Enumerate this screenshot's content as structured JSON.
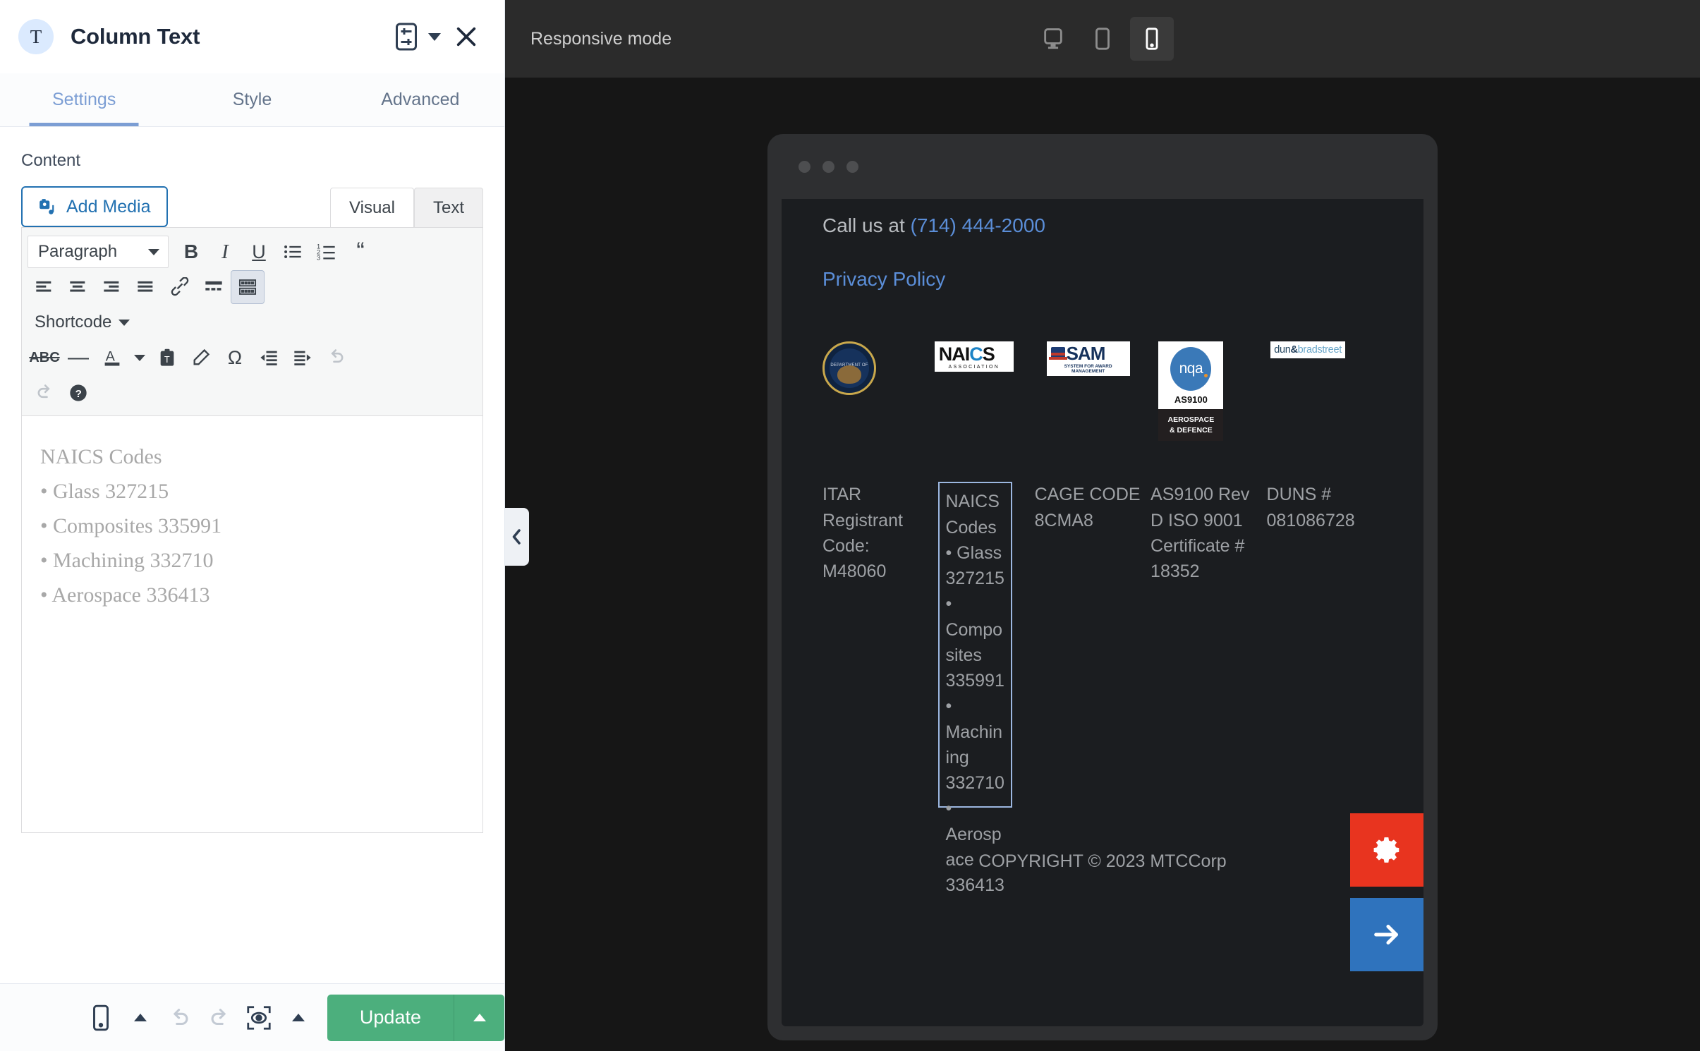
{
  "panel": {
    "type_icon_letter": "T",
    "title": "Column Text",
    "preset_icon": "preset-settings-icon",
    "caret_icon": "chevron-down-icon",
    "close_icon": "close-icon",
    "tabs": [
      {
        "label": "Settings",
        "active": true
      },
      {
        "label": "Style",
        "active": false
      },
      {
        "label": "Advanced",
        "active": false
      }
    ],
    "content_label": "Content",
    "add_media_label": "Add Media",
    "editor_tabs": [
      {
        "label": "Visual",
        "active": true
      },
      {
        "label": "Text",
        "active": false
      }
    ],
    "toolbar": {
      "paragraph_label": "Paragraph",
      "shortcode_label": "Shortcode",
      "buttons_row1": [
        "bold",
        "italic",
        "underline",
        "bullet-list",
        "numbered-list",
        "blockquote"
      ],
      "buttons_row2": [
        "align-left",
        "align-center",
        "align-right",
        "align-justify",
        "link",
        "read-more",
        "toolbar-toggle"
      ],
      "buttons_row3": [
        "strikethrough",
        "horizontal-rule",
        "text-color",
        "paste-as-text",
        "clear-formatting",
        "special-character",
        "outdent",
        "indent",
        "undo"
      ],
      "buttons_row4": [
        "redo",
        "keyboard-shortcuts"
      ]
    },
    "editor_content": {
      "heading": "NAICS Codes",
      "items": [
        "• Glass 327215",
        "• Composites 335991",
        "• Machining 332710",
        "• Aerospace 336413"
      ]
    },
    "footer": {
      "responsive_icon": "mobile-icon",
      "undo_icon": "undo-icon",
      "redo_icon": "redo-icon",
      "preview_icon": "preview-eye-icon",
      "update_label": "Update",
      "update_caret_icon": "chevron-up-icon"
    },
    "collapse_handle_icon": "chevron-left-icon"
  },
  "preview": {
    "responsive_label": "Responsive mode",
    "devices": [
      {
        "name": "desktop-icon",
        "active": false
      },
      {
        "name": "tablet-icon",
        "active": false
      },
      {
        "name": "mobile-icon",
        "active": true
      }
    ],
    "site": {
      "call_prefix": "Call us at ",
      "phone": "(714) 444-2000",
      "privacy_link": "Privacy Policy",
      "logos": [
        {
          "name": "department-of-state-seal",
          "line1": "DEPARTMENT OF STATE",
          "line2": "UNITED STATES OF AMERICA"
        },
        {
          "name": "naics-association-logo",
          "top": "NAICS",
          "sub": "ASSOCIATION"
        },
        {
          "name": "sam-logo",
          "top": "SAM",
          "sub": "SYSTEM FOR AWARD MANAGEMENT"
        },
        {
          "name": "nqa-as9100-logo",
          "brand": "nqa",
          "cert": "AS9100",
          "sector1": "AEROSPACE",
          "sector2": "& DEFENCE"
        },
        {
          "name": "dun-bradstreet-logo",
          "part1": "dun",
          "amp": "&",
          "part2": "bradstreet"
        }
      ],
      "columns": [
        {
          "name": "itar-column",
          "text": "ITAR Registrant Code: M48060",
          "selected": false
        },
        {
          "name": "naics-column",
          "text": "NAICS Codes • Glass 327215 • Composites 335991 • Machining 332710 • Aerospace 336413",
          "selected": true
        },
        {
          "name": "cage-column",
          "text": "CAGE CODE 8CMA8",
          "selected": false
        },
        {
          "name": "as9100-column",
          "text": "AS9100 Rev D ISO 9001 Certificate # 18352",
          "selected": false
        },
        {
          "name": "duns-column",
          "text": "DUNS # 081086728",
          "selected": false
        }
      ],
      "copyright": "COPYRIGHT © 2023 MTCCorp",
      "fabs": [
        {
          "name": "settings-gear-fab",
          "icon": "gear-icon",
          "color": "#e8341f"
        },
        {
          "name": "next-arrow-fab",
          "icon": "arrow-right-icon",
          "color": "#2f73bd"
        }
      ]
    }
  }
}
